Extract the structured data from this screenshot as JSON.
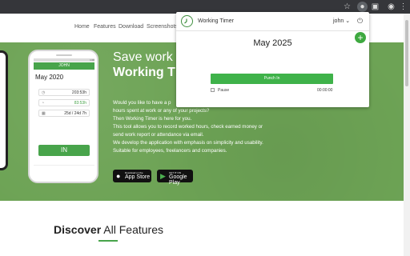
{
  "browser": {
    "icons": [
      "star-icon",
      "extension-active-icon",
      "puzzle-icon",
      "profile-icon",
      "menu-icon"
    ]
  },
  "nav": {
    "items": [
      "Home",
      "Features",
      "Download",
      "Screenshots"
    ]
  },
  "hero": {
    "title_line1": "Save work",
    "title_line2": "Working T",
    "paragraph": [
      "Would you like to have a p",
      "hours spent at work or any of your projects?",
      "Then Working Timer is here for you.",
      "This tool allows you to record worked hours, check earned money or",
      "send work report or attendance via email.",
      "We develop the application with emphasis on simplicity and usability.",
      "Suitable for employees, freelancers and companies."
    ],
    "app_store": {
      "small": "Download on the",
      "big": "App Store"
    },
    "google_play": {
      "small": "GET IT ON",
      "big": "Google Play"
    }
  },
  "phone": {
    "status_time": "1:00",
    "header_user": "JOHN",
    "month": "May 2020",
    "rows": [
      "203:53h",
      "83:53h",
      "25d / 24d 7h"
    ],
    "in_label": "IN"
  },
  "popup": {
    "title": "Working Timer",
    "user": "john",
    "month": "May 2025",
    "punch_label": "Punch In",
    "pause_label": "Pause",
    "pause_time": "00:00:00"
  },
  "discover": {
    "bold": "Discover",
    "rest": "All Features"
  },
  "colors": {
    "accent": "#3fb24a",
    "hero_green": "#6da355",
    "toolbar": "#35363a"
  }
}
